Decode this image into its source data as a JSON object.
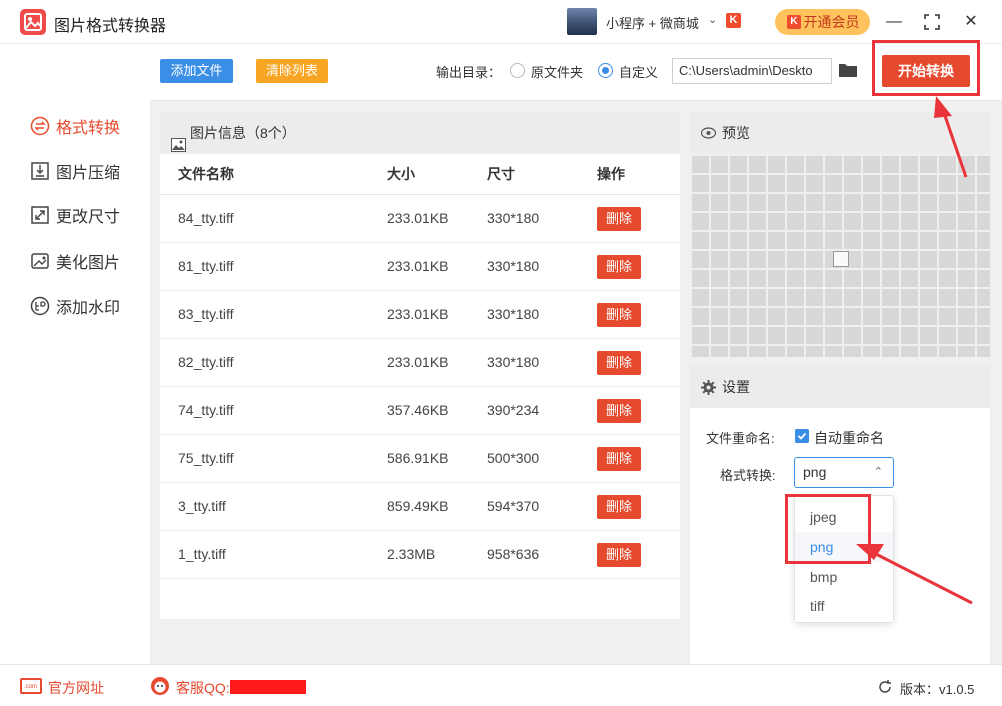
{
  "app": {
    "title": "图片格式转换器",
    "mini_program": "小程序 + 微商城",
    "vip_label": "开通会员",
    "k_badge": "K"
  },
  "sidebar": {
    "items": [
      {
        "label": "格式转换",
        "icon": "convert-icon",
        "active": true
      },
      {
        "label": "图片压缩",
        "icon": "compress-icon",
        "active": false
      },
      {
        "label": "更改尺寸",
        "icon": "resize-icon",
        "active": false
      },
      {
        "label": "美化图片",
        "icon": "beautify-icon",
        "active": false
      },
      {
        "label": "添加水印",
        "icon": "watermark-icon",
        "active": false
      }
    ]
  },
  "toolbar": {
    "add_label": "添加文件",
    "clear_label": "清除列表",
    "output_label": "输出目录：",
    "radio_original": "原文件夹",
    "radio_custom": "自定义",
    "path_value": "C:\\Users\\admin\\Deskto",
    "start_label": "开始转换"
  },
  "list": {
    "header": "图片信息（8个）",
    "columns": [
      "文件名称",
      "大小",
      "尺寸",
      "操作"
    ],
    "delete_label": "删除",
    "rows": [
      {
        "name": "84_tty.tiff",
        "size": "233.01KB",
        "dims": "330*180"
      },
      {
        "name": "81_tty.tiff",
        "size": "233.01KB",
        "dims": "330*180"
      },
      {
        "name": "83_tty.tiff",
        "size": "233.01KB",
        "dims": "330*180"
      },
      {
        "name": "82_tty.tiff",
        "size": "233.01KB",
        "dims": "330*180"
      },
      {
        "name": "74_tty.tiff",
        "size": "357.46KB",
        "dims": "390*234"
      },
      {
        "name": "75_tty.tiff",
        "size": "586.91KB",
        "dims": "500*300"
      },
      {
        "name": "3_tty.tiff",
        "size": "859.49KB",
        "dims": "594*370"
      },
      {
        "name": "1_tty.tiff",
        "size": "2.33MB",
        "dims": "958*636"
      }
    ]
  },
  "preview": {
    "title": "预览"
  },
  "settings": {
    "title": "设置",
    "rename_label": "文件重命名:",
    "auto_rename_label": "自动重命名",
    "format_label": "格式转换:",
    "format_value": "png",
    "options": [
      "jpeg",
      "png",
      "bmp",
      "tiff"
    ]
  },
  "footer": {
    "website": "官方网址",
    "com_icon_text": ".com",
    "service_qq": "客服QQ:",
    "version": "版本：v1.0.5"
  },
  "colors": {
    "accent": "#e64a2e",
    "blue": "#3a8ee6",
    "orange": "#f7a522",
    "annotation": "#e8343a"
  }
}
